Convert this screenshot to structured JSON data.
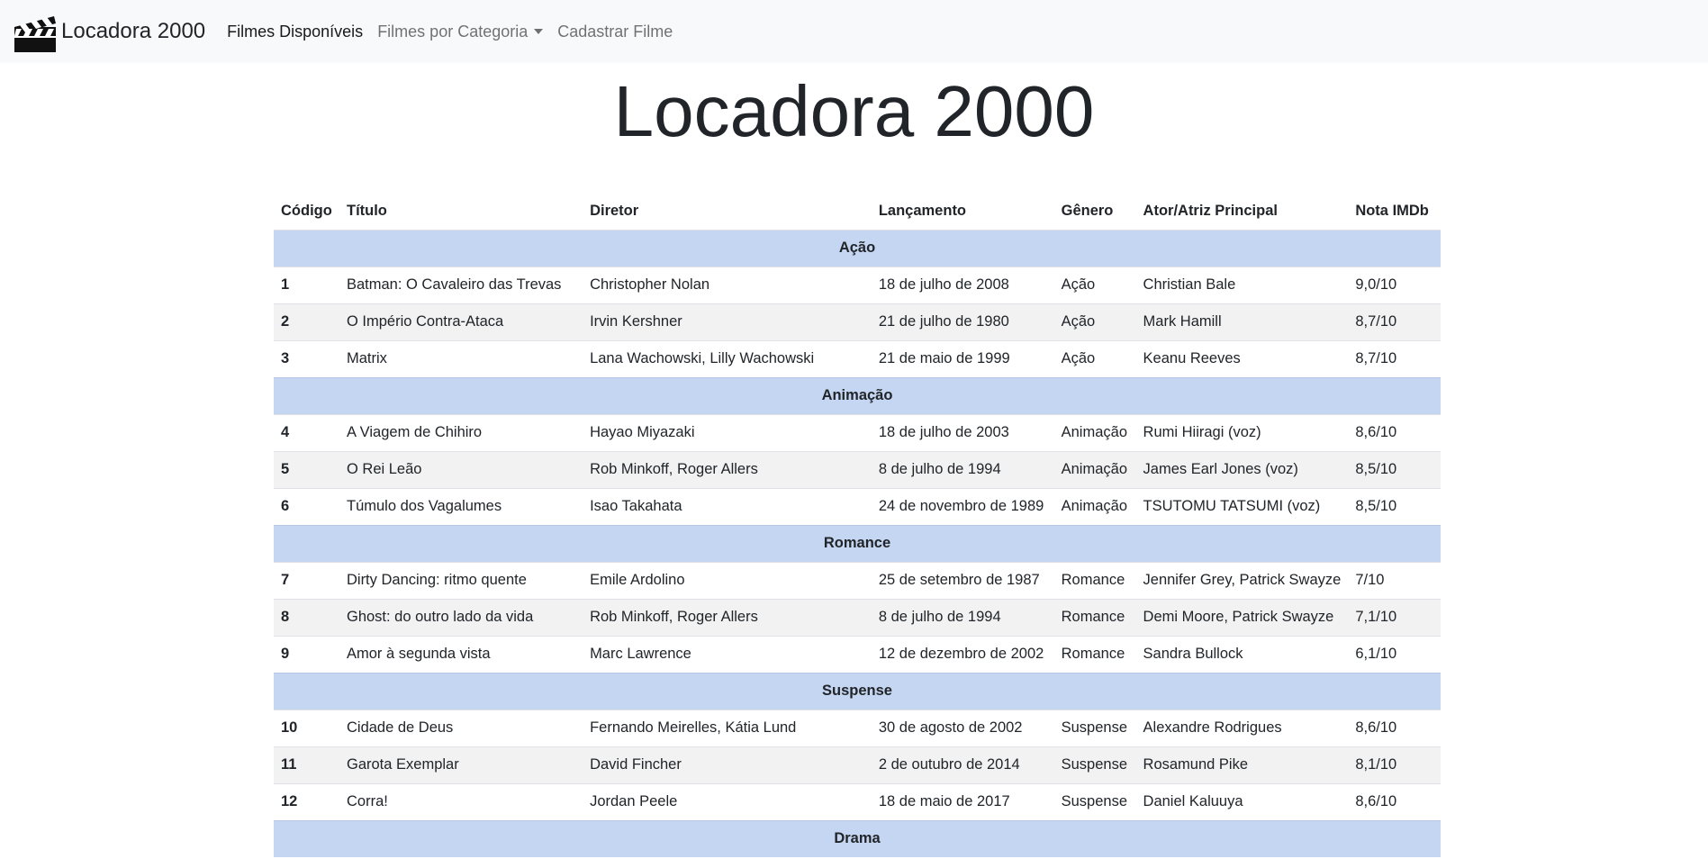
{
  "nav": {
    "brand": "Locadora 2000",
    "links": [
      "Filmes Disponíveis",
      "Filmes por Categoria",
      "Cadastrar Filme"
    ]
  },
  "title": "Locadora 2000",
  "table": {
    "headers": [
      "Código",
      "Título",
      "Diretor",
      "Lançamento",
      "Gênero",
      "Ator/Atriz Principal",
      "Nota IMDb"
    ],
    "categories": [
      {
        "name": "Ação",
        "rows": [
          [
            "1",
            "Batman: O Cavaleiro das Trevas",
            "Christopher Nolan",
            "18 de julho de 2008",
            "Ação",
            "Christian Bale",
            "9,0/10"
          ],
          [
            "2",
            "O Império Contra-Ataca",
            "Irvin Kershner",
            "21 de julho de 1980",
            "Ação",
            "Mark Hamill",
            "8,7/10"
          ],
          [
            "3",
            "Matrix",
            "Lana Wachowski, Lilly Wachowski",
            "21 de maio de 1999",
            "Ação",
            "Keanu Reeves",
            "8,7/10"
          ]
        ]
      },
      {
        "name": "Animação",
        "rows": [
          [
            "4",
            "A Viagem de Chihiro",
            "Hayao Miyazaki",
            "18 de julho de 2003",
            "Animação",
            "Rumi Hiiragi (voz)",
            "8,6/10"
          ],
          [
            "5",
            "O Rei Leão",
            "Rob Minkoff, Roger Allers",
            "8 de julho de 1994",
            "Animação",
            "James Earl Jones (voz)",
            "8,5/10"
          ],
          [
            "6",
            "Túmulo dos Vagalumes",
            "Isao Takahata",
            "24 de novembro de 1989",
            "Animação",
            "TSUTOMU TATSUMI (voz)",
            "8,5/10"
          ]
        ]
      },
      {
        "name": "Romance",
        "rows": [
          [
            "7",
            "Dirty Dancing: ritmo quente",
            "Emile Ardolino",
            "25 de setembro de 1987",
            "Romance",
            "Jennifer Grey, Patrick Swayze",
            "7/10"
          ],
          [
            "8",
            "Ghost: do outro lado da vida",
            "Rob Minkoff, Roger Allers",
            "8 de julho de 1994",
            "Romance",
            "Demi Moore, Patrick Swayze",
            "7,1/10"
          ],
          [
            "9",
            "Amor à segunda vista",
            "Marc Lawrence",
            "12 de dezembro de 2002",
            "Romance",
            "Sandra Bullock",
            "6,1/10"
          ]
        ]
      },
      {
        "name": "Suspense",
        "rows": [
          [
            "10",
            "Cidade de Deus",
            "Fernando Meirelles, Kátia Lund",
            "30 de agosto de 2002",
            "Suspense",
            "Alexandre Rodrigues",
            "8,6/10"
          ],
          [
            "11",
            "Garota Exemplar",
            "David Fincher",
            "2 de outubro de 2014",
            "Suspense",
            "Rosamund Pike",
            "8,1/10"
          ],
          [
            "12",
            "Corra!",
            "Jordan Peele",
            "18 de maio de 2017",
            "Suspense",
            "Daniel Kaluuya",
            "8,6/10"
          ]
        ]
      },
      {
        "name": "Drama",
        "rows": []
      }
    ]
  },
  "colors": {
    "navbar_bg": "#f8f9fa",
    "category_row_bg": "#c5d6f2",
    "striped_row_bg": "#f2f2f2"
  }
}
